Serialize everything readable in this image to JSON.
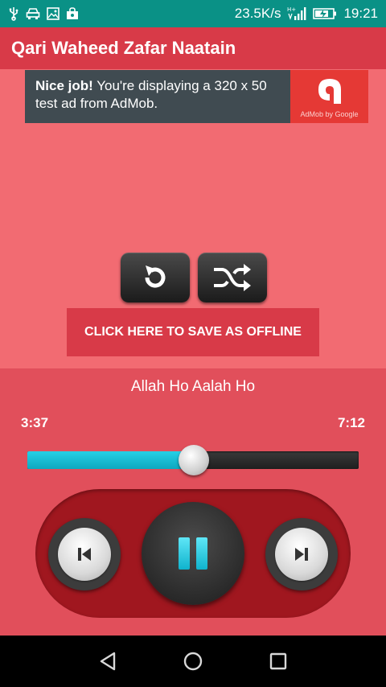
{
  "status_bar": {
    "network_speed": "23.5K/s",
    "network_type": "H+",
    "time": "19:21",
    "icons": [
      "usb-icon",
      "car-icon",
      "image-icon",
      "bag-icon",
      "signal-icon",
      "battery-charging-icon"
    ]
  },
  "app_bar": {
    "title": "Qari Waheed Zafar Naatain"
  },
  "ad": {
    "bold_text": "Nice job!",
    "text": " You're displaying a 320 x 50 test ad from AdMob.",
    "logo_text": "AdMob by Google"
  },
  "controls": {
    "repeat_icon": "repeat-icon",
    "shuffle_icon": "shuffle-icon",
    "save_offline_label": "CLICK HERE TO SAVE AS OFFLINE"
  },
  "player": {
    "track_title": "Allah Ho Aalah Ho",
    "current_time": "3:37",
    "total_time": "7:12",
    "progress_fraction": 0.502,
    "buttons": [
      "previous-icon",
      "pause-icon",
      "next-icon"
    ]
  },
  "nav_bar": {
    "icons": [
      "back-icon",
      "home-icon",
      "recents-icon"
    ]
  },
  "colors": {
    "status_bar": "#0a9186",
    "app_bar": "#d83a48",
    "background": "#f26b72",
    "player_panel": "#e14f5b",
    "controls_panel": "#a0171f",
    "seek_fill": "#1fc2d9"
  }
}
